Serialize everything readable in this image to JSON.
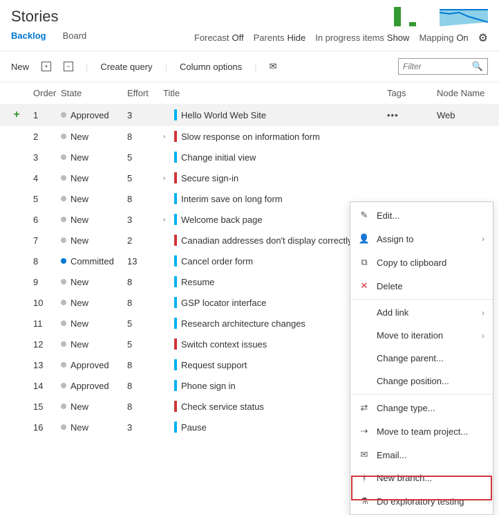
{
  "page_title": "Stories",
  "tabs": {
    "backlog": "Backlog",
    "board": "Board"
  },
  "options": {
    "forecast_label": "Forecast",
    "forecast_value": "Off",
    "parents_label": "Parents",
    "parents_value": "Hide",
    "inprogress_label": "In progress items",
    "inprogress_value": "Show",
    "mapping_label": "Mapping",
    "mapping_value": "On"
  },
  "toolbar": {
    "new": "New",
    "create_query": "Create query",
    "column_options": "Column options",
    "filter_placeholder": "Filter"
  },
  "columns": {
    "order": "Order",
    "state": "State",
    "effort": "Effort",
    "title": "Title",
    "tags": "Tags",
    "node": "Node Name"
  },
  "rows": [
    {
      "order": "1",
      "state": "Approved",
      "stateDot": "grey",
      "effort": "3",
      "bar": "blue",
      "hasChildren": false,
      "title": "Hello World Web Site",
      "node": "Web",
      "hover": true
    },
    {
      "order": "2",
      "state": "New",
      "stateDot": "grey",
      "effort": "8",
      "bar": "red",
      "hasChildren": true,
      "title": "Slow response on information form"
    },
    {
      "order": "3",
      "state": "New",
      "stateDot": "grey",
      "effort": "5",
      "bar": "blue",
      "hasChildren": false,
      "title": "Change initial view"
    },
    {
      "order": "4",
      "state": "New",
      "stateDot": "grey",
      "effort": "5",
      "bar": "red",
      "hasChildren": true,
      "title": "Secure sign-in"
    },
    {
      "order": "5",
      "state": "New",
      "stateDot": "grey",
      "effort": "8",
      "bar": "blue",
      "hasChildren": false,
      "title": "Interim save on long form"
    },
    {
      "order": "6",
      "state": "New",
      "stateDot": "grey",
      "effort": "3",
      "bar": "blue",
      "hasChildren": true,
      "title": "Welcome back page"
    },
    {
      "order": "7",
      "state": "New",
      "stateDot": "grey",
      "effort": "2",
      "bar": "red",
      "hasChildren": false,
      "title": "Canadian addresses don't display correctly"
    },
    {
      "order": "8",
      "state": "Committed",
      "stateDot": "blue",
      "effort": "13",
      "bar": "blue",
      "hasChildren": false,
      "title": "Cancel order form"
    },
    {
      "order": "9",
      "state": "New",
      "stateDot": "grey",
      "effort": "8",
      "bar": "blue",
      "hasChildren": false,
      "title": "Resume"
    },
    {
      "order": "10",
      "state": "New",
      "stateDot": "grey",
      "effort": "8",
      "bar": "blue",
      "hasChildren": false,
      "title": "GSP locator interface"
    },
    {
      "order": "11",
      "state": "New",
      "stateDot": "grey",
      "effort": "5",
      "bar": "blue",
      "hasChildren": false,
      "title": "Research architecture changes"
    },
    {
      "order": "12",
      "state": "New",
      "stateDot": "grey",
      "effort": "5",
      "bar": "red",
      "hasChildren": false,
      "title": "Switch context issues"
    },
    {
      "order": "13",
      "state": "Approved",
      "stateDot": "grey",
      "effort": "8",
      "bar": "blue",
      "hasChildren": false,
      "title": "Request support"
    },
    {
      "order": "14",
      "state": "Approved",
      "stateDot": "grey",
      "effort": "8",
      "bar": "blue",
      "hasChildren": false,
      "title": "Phone sign in"
    },
    {
      "order": "15",
      "state": "New",
      "stateDot": "grey",
      "effort": "8",
      "bar": "red",
      "hasChildren": false,
      "title": "Check service status"
    },
    {
      "order": "16",
      "state": "New",
      "stateDot": "grey",
      "effort": "3",
      "bar": "blue",
      "hasChildren": false,
      "title": "Pause"
    }
  ],
  "menu": {
    "edit": "Edit...",
    "assign_to": "Assign to",
    "copy": "Copy to clipboard",
    "delete": "Delete",
    "add_link": "Add link",
    "move_iteration": "Move to iteration",
    "change_parent": "Change parent...",
    "change_position": "Change position...",
    "change_type": "Change type...",
    "move_team": "Move to team project...",
    "email": "Email...",
    "new_branch": "New branch...",
    "exploratory": "Do exploratory testing"
  }
}
